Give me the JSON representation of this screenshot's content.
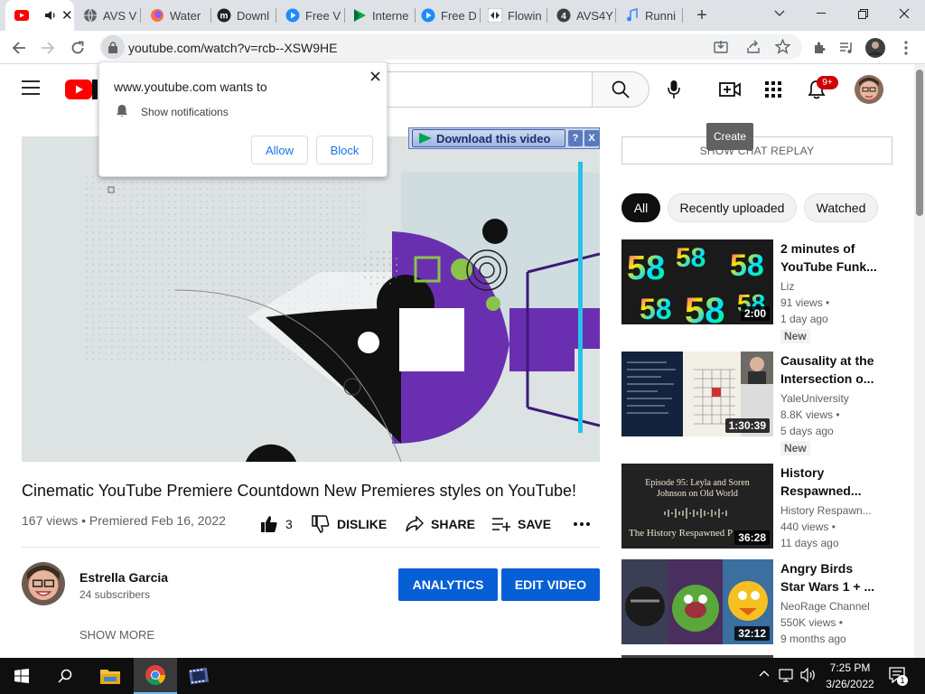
{
  "browser": {
    "tabs": [
      {
        "label": "",
        "favicon": "youtube-icon",
        "audio": "speaker-icon"
      },
      {
        "label": "AVS V",
        "favicon": "globe-icon"
      },
      {
        "label": "Water",
        "favicon": "firefox-icon"
      },
      {
        "label": "Downl",
        "favicon": "m-icon"
      },
      {
        "label": "Free V",
        "favicon": "play-circle-icon"
      },
      {
        "label": "Interne",
        "favicon": "green-play-icon"
      },
      {
        "label": "Free D",
        "favicon": "play-circle-icon"
      },
      {
        "label": "Flowin",
        "favicon": "arrows-icon"
      },
      {
        "label": "AVS4Y",
        "favicon": "avs4you-icon"
      },
      {
        "label": "Runni",
        "favicon": "music-note-icon"
      }
    ],
    "url": "youtube.com/watch?v=rcb--XSW9HE"
  },
  "notification_prompt": {
    "title": "www.youtube.com wants to",
    "permission": "Show notifications",
    "allow_label": "Allow",
    "block_label": "Block"
  },
  "youtube_header": {
    "notification_count": "9+",
    "tooltip": "Create"
  },
  "download_overlay": {
    "label": "Download this video",
    "help": "?",
    "close": "X"
  },
  "video": {
    "title": "Cinematic YouTube Premiere Countdown New Premieres styles on YouTube!",
    "meta": "167 views • Premiered Feb 16, 2022",
    "likes": "3",
    "dislike_label": "DISLIKE",
    "share_label": "SHARE",
    "save_label": "SAVE"
  },
  "channel": {
    "name": "Estrella Garcia",
    "subscribers": "24 subscribers",
    "analytics_label": "ANALYTICS",
    "edit_label": "EDIT VIDEO",
    "show_more": "SHOW MORE"
  },
  "sidebar": {
    "chat_replay": "SHOW CHAT REPLAY",
    "chips": [
      "All",
      "Recently uploaded",
      "Watched"
    ],
    "recommendations": [
      {
        "title": "2 minutes of YouTube Funk...",
        "channel": "Liz",
        "views": "91 views •",
        "age": "1 day ago",
        "badge": "New",
        "duration": "2:00"
      },
      {
        "title": "Causality at the Intersection o...",
        "channel": "YaleUniversity",
        "views": "8.8K views •",
        "age": "5 days ago",
        "badge": "New",
        "duration": "1:30:39"
      },
      {
        "title": "History Respawned...",
        "channel": "History Respawn...",
        "views": "440 views •",
        "age": "11 days ago",
        "badge": "",
        "duration": "36:28",
        "thumb_text1": "Episode 95: Leyla and Soren Johnson on Old World",
        "thumb_text2": "The History Respawned P"
      },
      {
        "title": "Angry Birds Star Wars 1 + ...",
        "channel": "NeoRage Channel",
        "views": "550K views •",
        "age": "9 months ago",
        "badge": "",
        "duration": "32:12"
      }
    ]
  },
  "taskbar": {
    "time": "7:25 PM",
    "date": "3/26/2022",
    "notification_count": "1"
  },
  "colors": {
    "youtube_red": "#ff0000",
    "accent_blue": "#065fd4",
    "chrome_tabstrip": "#dee1e6"
  }
}
